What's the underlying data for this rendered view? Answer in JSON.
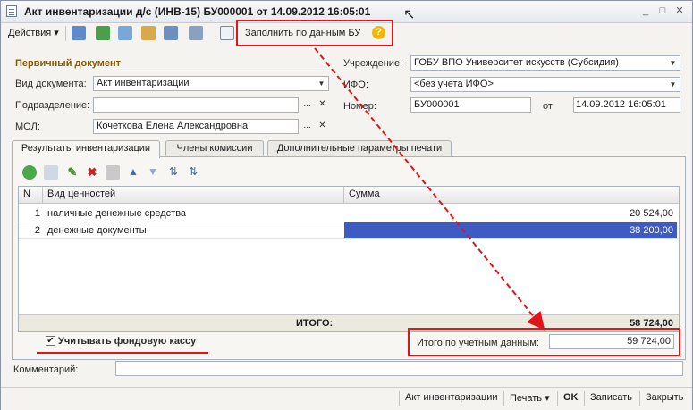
{
  "window": {
    "title": "Акт инвентаризации д/с (ИНВ-15) БУ000001 от 14.09.2012 16:05:01"
  },
  "toolbar": {
    "actions_label": "Действия",
    "fill_label": "Заполнить по данным БУ",
    "help_label": "?"
  },
  "header": {
    "section_title": "Первичный документ",
    "doc_type_label": "Вид документа:",
    "doc_type_value": "Акт инвентаризации",
    "division_label": "Подразделение:",
    "division_value": "",
    "mol_label": "МОЛ:",
    "mol_value": "Кочеткова Елена Александровна",
    "institution_label": "Учреждение:",
    "institution_value": "ГОБУ ВПО Университет искусств (Субсидия)",
    "ifo_label": "ИФО:",
    "ifo_value": "<без учета ИФО>",
    "number_label": "Номер:",
    "number_value": "БУ000001",
    "date_label": "от",
    "date_value": "14.09.2012 16:05:01"
  },
  "tabs": [
    {
      "label": "Результаты инвентаризации"
    },
    {
      "label": "Члены комиссии"
    },
    {
      "label": "Дополнительные параметры печати"
    }
  ],
  "table": {
    "headers": {
      "n": "N",
      "kind": "Вид ценностей",
      "sum": "Сумма"
    },
    "rows": [
      {
        "n": "1",
        "kind": "наличные денежные средства",
        "sum": "20 524,00"
      },
      {
        "n": "2",
        "kind": "денежные документы",
        "sum": "38 200,00"
      }
    ],
    "total_label": "ИТОГО:",
    "total_value": "58 724,00"
  },
  "fund_checkbox": {
    "label": "Учитывать фондовую кассу",
    "checked": true
  },
  "accounting_total": {
    "label": "Итого по учетным данным:",
    "value": "59 724,00"
  },
  "comment": {
    "label": "Комментарий:",
    "value": ""
  },
  "statusbar": {
    "act_label": "Акт инвентаризации",
    "print_label": "Печать",
    "ok_label": "OK",
    "save_label": "Записать",
    "close_label": "Закрыть"
  },
  "colors": {
    "accent_red": "#e0151b",
    "selection": "#3d5bc2",
    "section_title": "#8a5a00"
  }
}
